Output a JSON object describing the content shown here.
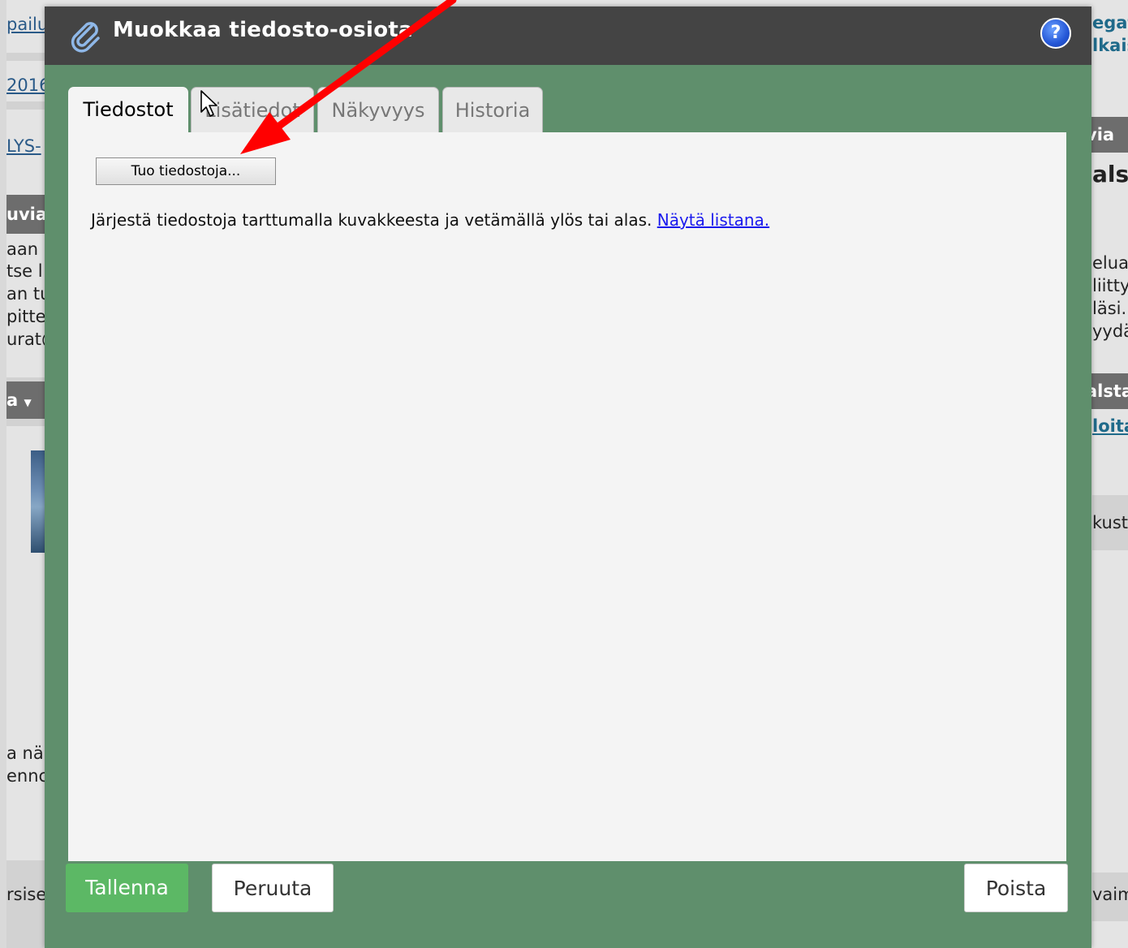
{
  "background": {
    "left_fragments": [
      "pailu",
      "2016",
      "LYS-",
      "uvia",
      "aan",
      "tse l",
      "an tu",
      "pitte",
      "urat@",
      "a",
      "a nä",
      "ennc",
      "rsise"
    ],
    "right_fragments": [
      "egat",
      "lkais",
      "via",
      "als",
      "elua",
      "liitty",
      "läsi.",
      "yydä",
      "alsta",
      "loita",
      "kust",
      "vaim"
    ]
  },
  "modal": {
    "title": "Muokkaa tiedosto-osiota",
    "help_symbol": "?",
    "tabs": [
      {
        "label": "Tiedostot",
        "active": true
      },
      {
        "label": "Lisätiedot",
        "active": false
      },
      {
        "label": "Näkyvyys",
        "active": false
      },
      {
        "label": "Historia",
        "active": false
      }
    ],
    "import_button": "Tuo tiedostoja...",
    "instruction": "Järjestä tiedostoja tarttumalla kuvakkeesta ja vetämällä ylös tai alas.",
    "instruction_link": "Näytä listana.",
    "footer": {
      "save": "Tallenna",
      "cancel": "Peruuta",
      "delete": "Poista"
    }
  },
  "colors": {
    "modal_bg": "#5f8f6c",
    "header_bg": "#444444",
    "save_green": "#5cb865",
    "arrow_red": "#ff0000"
  },
  "icons": {
    "title_icon": "paperclip-icon",
    "help_icon": "help-icon",
    "cursor": "mouse-pointer-icon",
    "annotation": "red-arrow-annotation"
  }
}
